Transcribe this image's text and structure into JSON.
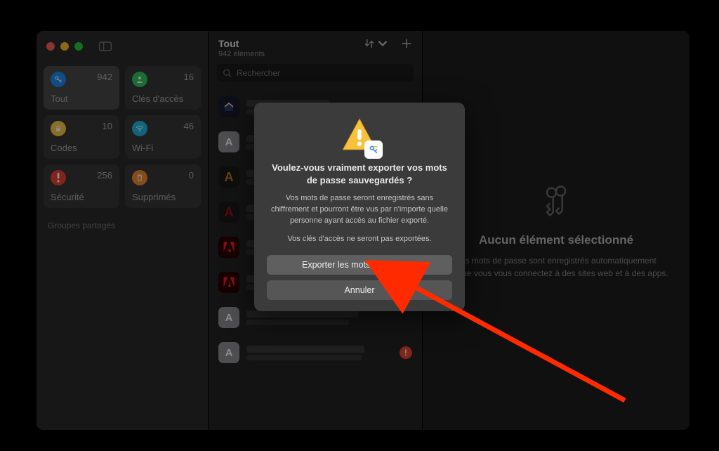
{
  "sidebar": {
    "categories": [
      {
        "label": "Tout",
        "count": "942",
        "icon": "key-icon",
        "bg": "#1f8af0",
        "selected": true
      },
      {
        "label": "Clés d'accès",
        "count": "16",
        "icon": "person-icon",
        "bg": "#34c759",
        "selected": false
      },
      {
        "label": "Codes",
        "count": "10",
        "icon": "lock-icon",
        "bg": "#f7c846",
        "selected": false
      },
      {
        "label": "Wi-Fi",
        "count": "46",
        "icon": "wifi-icon",
        "bg": "#1fb6e0",
        "selected": false
      },
      {
        "label": "Sécurité",
        "count": "256",
        "icon": "warn-icon",
        "bg": "#e74432",
        "selected": false
      },
      {
        "label": "Supprimés",
        "count": "0",
        "icon": "trash-icon",
        "bg": "#f28b30",
        "selected": false
      }
    ],
    "shared_groups_label": "Groupes partagés"
  },
  "middle": {
    "title": "Tout",
    "subtitle": "942 éléments",
    "search_placeholder": "Rechercher",
    "items": [
      {
        "avatar_bg": "#1a1a2e",
        "avatar_type": "svg-house",
        "avatar_letter": "",
        "warn": false
      },
      {
        "avatar_bg": "#8e8e93",
        "avatar_type": "letter",
        "avatar_letter": "A",
        "warn": false
      },
      {
        "avatar_bg": "#1a1a1a",
        "avatar_type": "letter-stylized",
        "avatar_letter": "A",
        "text_color": "#b8792a",
        "warn": false
      },
      {
        "avatar_bg": "#1a1a1a",
        "avatar_type": "letter-stylized",
        "avatar_letter": "A",
        "text_color": "#a11",
        "warn": false
      },
      {
        "avatar_bg": "#2a0000",
        "avatar_type": "adobe",
        "avatar_letter": "A",
        "warn": false
      },
      {
        "avatar_bg": "#2a0000",
        "avatar_type": "adobe",
        "avatar_letter": "A",
        "warn": false
      },
      {
        "avatar_bg": "#8e8e93",
        "avatar_type": "letter",
        "avatar_letter": "A",
        "warn": false
      },
      {
        "avatar_bg": "#8e8e93",
        "avatar_type": "letter",
        "avatar_letter": "A",
        "warn": true
      }
    ]
  },
  "right": {
    "heading": "Aucun élément sélectionné",
    "body": "Les mots de passe sont enregistrés automatiquement lorsque vous vous connectez à des sites web et à des apps."
  },
  "dialog": {
    "title": "Voulez-vous vraiment exporter vos mots de passe sauvegardés ?",
    "body": "Vos mots de passe seront enregistrés sans chiffrement et pourront être vus par n'importe quelle personne ayant accès au fichier exporté.",
    "body2": "Vos clés d'accès ne seront pas exportées.",
    "primary_button": "Exporter les mots de passe…",
    "cancel_button": "Annuler"
  },
  "colors": {
    "arrow": "#ff2a00"
  }
}
